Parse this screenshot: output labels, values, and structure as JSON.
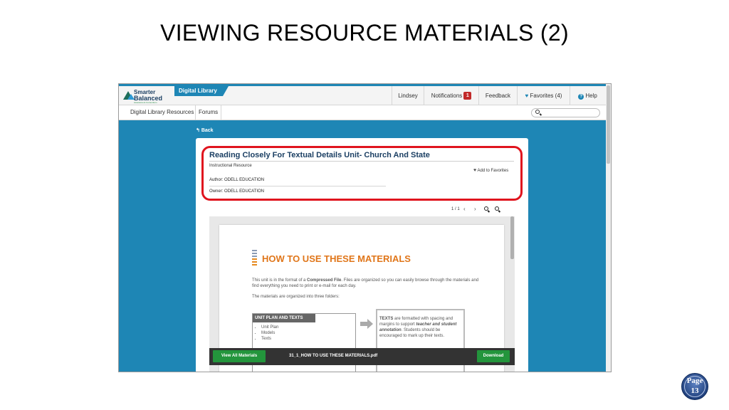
{
  "slide": {
    "title": "VIEWING RESOURCE MATERIALS (2)",
    "page_badge": {
      "word": "Page",
      "number": "13"
    }
  },
  "header": {
    "logo_line1": "Smarter",
    "logo_line2": "Balanced",
    "logo_line3": "Assessment Consortium",
    "app_tab": "Digital Library",
    "user": "Lindsey",
    "notifications_label": "Notifications",
    "notifications_count": "1",
    "feedback_label": "Feedback",
    "favorites_label": "Favorites (4)",
    "help_label": "Help"
  },
  "subnav": {
    "items": [
      "Digital Library Resources",
      "Forums"
    ],
    "search_placeholder": ""
  },
  "back_label": "Back",
  "resource": {
    "title": "Reading Closely For Textual Details Unit- Church And State",
    "type": "Instructional Resource",
    "add_favorites": "Add to Favorites",
    "author": "Author: ODELL EDUCATION",
    "owner": "Owner: ODELL EDUCATION"
  },
  "viewer": {
    "page_indicator": "1 / 1",
    "file_name": "31_1_HOW TO USE THESE MATERIALS.pdf",
    "view_all_button": "View All Materials",
    "download_button": "Download"
  },
  "document": {
    "heading": "HOW TO USE THESE MATERIALS",
    "para1_a": "This unit is in the format of a ",
    "para1_b": "Compressed File",
    "para1_c": ". Files are organized so you can easily browse through the materials and find everything you need to print or e-mail for each day.",
    "para2": "The materials are organized into three folders:",
    "box1_title": "UNIT PLAN AND TEXTS",
    "box1_items": [
      "Unit Plan",
      "Models",
      "Texts"
    ],
    "box2_a": "TEXTS",
    "box2_b": " are formatted with spacing and margins to support ",
    "box2_c": "teacher and student annotation",
    "box2_d": ". Students should be encouraged to mark up their texts."
  },
  "colors": {
    "brand_blue": "#1e86b5",
    "title_navy": "#1b3f63",
    "highlight_red": "#e0141e",
    "doc_orange": "#e0761a",
    "button_green": "#23953c"
  }
}
